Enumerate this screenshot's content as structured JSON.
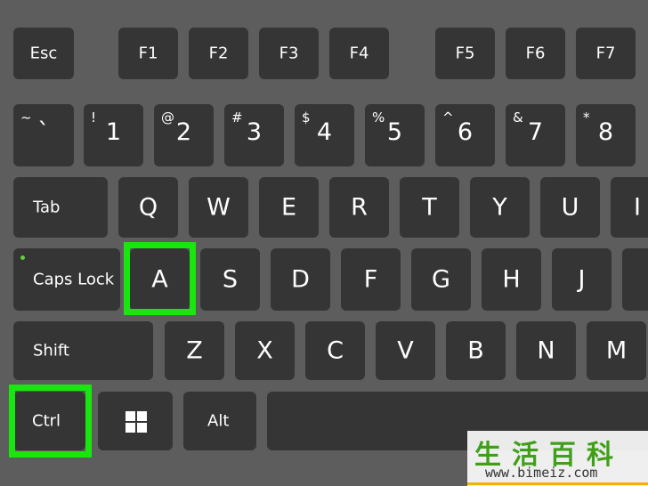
{
  "function_row": [
    "Esc",
    "F1",
    "F2",
    "F3",
    "F4",
    "F5",
    "F6",
    "F7"
  ],
  "number_row": [
    {
      "symbol": "~",
      "main": "`"
    },
    {
      "symbol": "!",
      "main": "1"
    },
    {
      "symbol": "@",
      "main": "2"
    },
    {
      "symbol": "#",
      "main": "3"
    },
    {
      "symbol": "$",
      "main": "4"
    },
    {
      "symbol": "%",
      "main": "5"
    },
    {
      "symbol": "^",
      "main": "6"
    },
    {
      "symbol": "&",
      "main": "7"
    },
    {
      "symbol": "*",
      "main": "8"
    }
  ],
  "tab_row": {
    "tab": "Tab",
    "letters": [
      "Q",
      "W",
      "E",
      "R",
      "T",
      "Y",
      "U",
      "I"
    ]
  },
  "caps_row": {
    "caps": "Caps Lock",
    "letters": [
      "A",
      "S",
      "D",
      "F",
      "G",
      "H",
      "J"
    ]
  },
  "shift_row": {
    "shift": "Shift",
    "letters": [
      "Z",
      "X",
      "C",
      "V",
      "B",
      "N",
      "M"
    ]
  },
  "bottom_row": {
    "ctrl": "Ctrl",
    "win_icon": "windows-logo-icon",
    "alt": "Alt"
  },
  "highlighted_keys": [
    "A",
    "Ctrl"
  ],
  "colors": {
    "background": "#5d5d5d",
    "key": "#353535",
    "highlight": "#19e60f"
  },
  "watermark": {
    "chars": "生活百科",
    "url": "www.bimeiz.com"
  }
}
